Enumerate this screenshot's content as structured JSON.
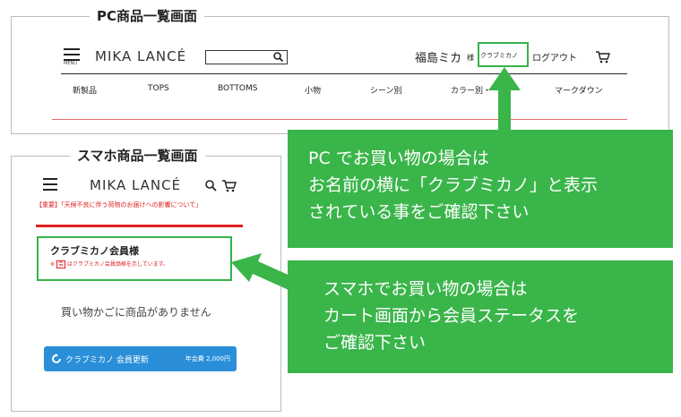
{
  "pc": {
    "section_title": "PC商品一覧画面",
    "menu_caption": "MENU",
    "logo": "MIKA LANCÉ",
    "search_placeholder": "",
    "user_name": "福島ミカ",
    "user_suffix": "様",
    "member_badge": "クラブミカノ",
    "logout": "ログアウト",
    "nav": [
      "新製品",
      "TOPS",
      "BOTTOMS",
      "小物",
      "シーン別",
      "カラー別・",
      "マークダウン"
    ]
  },
  "sp": {
    "section_title": "スマホ商品一覧画面",
    "logo": "MIKA LANCÉ",
    "notice": "【重要】「天候不良に伴う荷物のお届けへの影響について」",
    "member_title": "クラブミカノ会員様",
    "member_note_pre": "※",
    "member_note_mark": "会",
    "member_note_post": "はクラブミカノ会員価格を示しています。",
    "cart_empty": "買い物かごに商品がありません",
    "renew_button": "クラブミカノ 会員更新",
    "fee": "年会費 2,000円"
  },
  "callouts": {
    "pc": [
      "PC でお買い物の場合は",
      "お名前の横に「クラブミカノ」と表示",
      "されている事をご確認下さい"
    ],
    "sp": [
      "スマホでお買い物の場合は",
      "カート画面から会員ステータスを",
      "ご確認下さい"
    ]
  },
  "colors": {
    "accent_green": "#3ab54a",
    "notice_red": "#e02020",
    "button_blue": "#2a8fd8"
  },
  "icons": [
    "menu-icon",
    "search-icon",
    "cart-icon",
    "refresh-icon"
  ]
}
